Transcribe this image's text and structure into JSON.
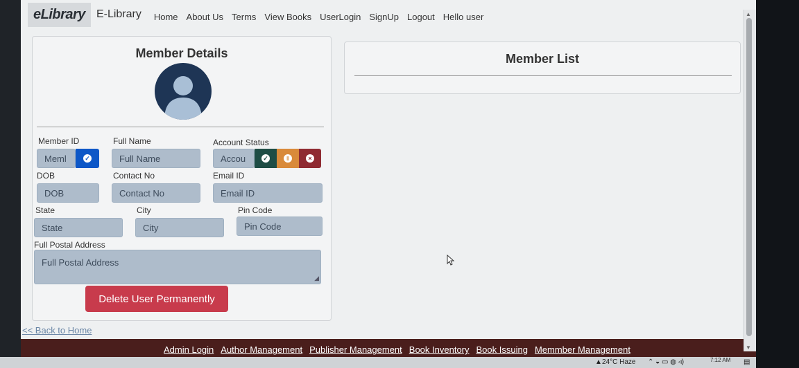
{
  "navbar": {
    "logo": "eLibrary",
    "brand": "E-Library",
    "links": [
      "Home",
      "About Us",
      "Terms",
      "View Books",
      "UserLogin",
      "SignUp",
      "Logout",
      "Hello user"
    ]
  },
  "member_details": {
    "title": "Member Details",
    "labels": {
      "member_id": "Member ID",
      "full_name": "Full Name",
      "account_status": "Account Status",
      "dob": "DOB",
      "contact_no": "Contact No",
      "email_id": "Email ID",
      "state": "State",
      "city": "City",
      "pin_code": "Pin Code",
      "postal_address": "Full Postal Address"
    },
    "placeholders": {
      "member_id": "Meml",
      "full_name": "Full Name",
      "account_status": "Accou",
      "dob": "DOB",
      "contact_no": "Contact No",
      "email_id": "Email ID",
      "state": "State",
      "city": "City",
      "pin_code": "Pin Code",
      "postal_address": "Full Postal Address"
    },
    "delete_button": "Delete User Permanently"
  },
  "member_list": {
    "title": "Member List"
  },
  "back_link": "<< Back to Home",
  "footer": {
    "links": [
      "Admin Login",
      "Author Management",
      "Publisher Management",
      "Book Inventory",
      "Book Issuing",
      "Memmber Management"
    ]
  },
  "taskbar": {
    "weather": "24°C  Haze",
    "time": "7:12 AM"
  },
  "colors": {
    "go_button": "#0d57c7",
    "active_status": "#1e4d45",
    "pending_status": "#d98a3a",
    "deactivate_status": "#8f2b32",
    "delete_button": "#c83b4c",
    "footer": "#4a1e1c"
  }
}
